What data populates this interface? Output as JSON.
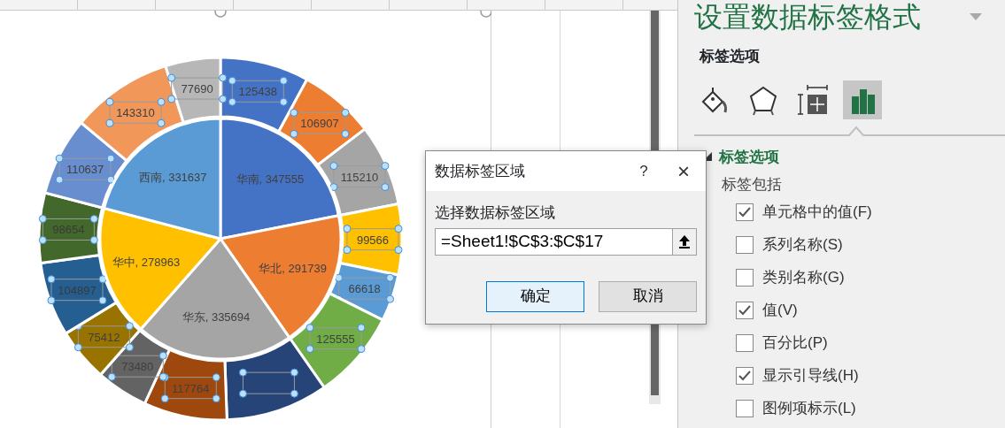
{
  "chart": {
    "chart_data": {
      "type": "pie",
      "data_labels": true,
      "series": [
        {
          "values": [
            347555,
            291739,
            335694,
            278963,
            331637
          ],
          "colors": [
            "#4472c4",
            "#ed7d31",
            "#a5a5a5",
            "#ffc000",
            "#5b9bd5"
          ],
          "value_labels": [
            "华南, 347555",
            "华北, 291739",
            "华东, 335694",
            "华中, 278963",
            "西南, 331637"
          ]
        },
        {
          "values": [
            125438,
            106907,
            115210,
            99566,
            66618,
            125555,
            144450,
            117764,
            73480,
            75412,
            104897,
            98654,
            110637,
            143310,
            77690
          ],
          "colors": [
            "#4472c4",
            "#ed7d31",
            "#a5a5a5",
            "#ffc000",
            "#5b9bd5",
            "#70ad47",
            "#264478",
            "#9e480e",
            "#636363",
            "#997300",
            "#255e91",
            "#43682b",
            "#698ed0",
            "#f1975a",
            "#b7b7b7"
          ],
          "value_labels": [
            "125438",
            "106907",
            "115210",
            "99566",
            "66618",
            "125555",
            null,
            "117764",
            "73480",
            "75412",
            "104897",
            "98654",
            "110637",
            "143310",
            "77690"
          ]
        }
      ]
    }
  },
  "dialog": {
    "title": "数据标签区域",
    "help": "?",
    "close": "×",
    "prompt": "选择数据标签区域",
    "value": "=Sheet1!$C$3:$C$17",
    "buttons": [
      {
        "label": "确定",
        "kind": "primary"
      },
      {
        "label": "取消",
        "kind": "secondary"
      }
    ]
  },
  "panel": {
    "title": "设置数据标签格式",
    "subtitle": "标签选项",
    "tabs": [
      {
        "kind": "fill",
        "selected": false
      },
      {
        "kind": "effects",
        "selected": false
      },
      {
        "kind": "size",
        "selected": false
      },
      {
        "kind": "options",
        "selected": true
      }
    ],
    "section": {
      "title": "标签选项",
      "expanded": true,
      "heading": "标签包括",
      "options": [
        {
          "label": "单元格中的值(F)",
          "checked": true
        },
        {
          "label": "系列名称(S)",
          "checked": false
        },
        {
          "label": "类别名称(G)",
          "checked": false
        },
        {
          "label": "值(V)",
          "checked": true
        },
        {
          "label": "百分比(P)",
          "checked": false
        },
        {
          "label": "显示引导线(H)",
          "checked": true
        },
        {
          "label": "图例项标示(L)",
          "checked": false
        }
      ]
    }
  }
}
